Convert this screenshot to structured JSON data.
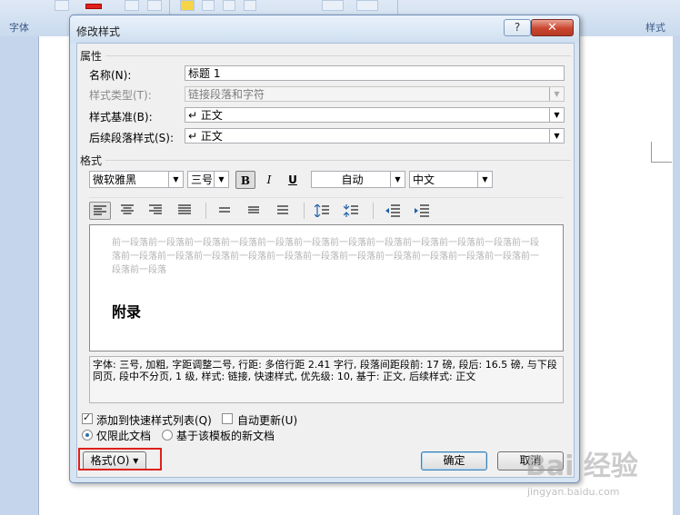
{
  "background": {
    "ribbon_group_left": "字体",
    "ribbon_group_right": "样式"
  },
  "dialog": {
    "title": "修改样式",
    "help_glyph": "?",
    "close_glyph": "✕",
    "properties": {
      "section": "属性",
      "name_label": "名称(N):",
      "name_value": "标题 1",
      "type_label": "样式类型(T):",
      "type_value": "链接段落和字符",
      "based_label": "样式基准(B):",
      "based_value": "↵ 正文",
      "next_label": "后续段落样式(S):",
      "next_value": "↵ 正文"
    },
    "format": {
      "section": "格式",
      "font": "微软雅黑",
      "size": "三号",
      "bold": "B",
      "italic": "I",
      "underline": "U",
      "color": "自动",
      "lang": "中文"
    },
    "preview": {
      "prev_para": "前一段落前一段落前一段落前一段落前一段落前一段落前一段落前一段落前一段落前一段落前一段落前一段落前一段落前一段落前一段落前一段落前一段落前一段落前一段落前一段落前一段落前一段落前一段落前一段落前一段落",
      "heading": "附录"
    },
    "description": "字体: 三号, 加粗, 字距调整二号, 行距: 多倍行距 2.41 字行, 段落间距段前: 17 磅, 段后: 16.5 磅, 与下段同页, 段中不分页, 1 级, 样式: 链接, 快速样式, 优先级: 10, 基于: 正文, 后续样式: 正文",
    "options": {
      "add_quick": "添加到快速样式列表(Q)",
      "auto_update": "自动更新(U)",
      "only_doc": "仅限此文档",
      "template_doc": "基于该模板的新文档"
    },
    "buttons": {
      "format": "格式(O) ▾",
      "ok": "确定",
      "cancel": "取消"
    }
  },
  "watermark": {
    "brand": "Bai 经验",
    "url": "jingyan.baidu.com"
  }
}
